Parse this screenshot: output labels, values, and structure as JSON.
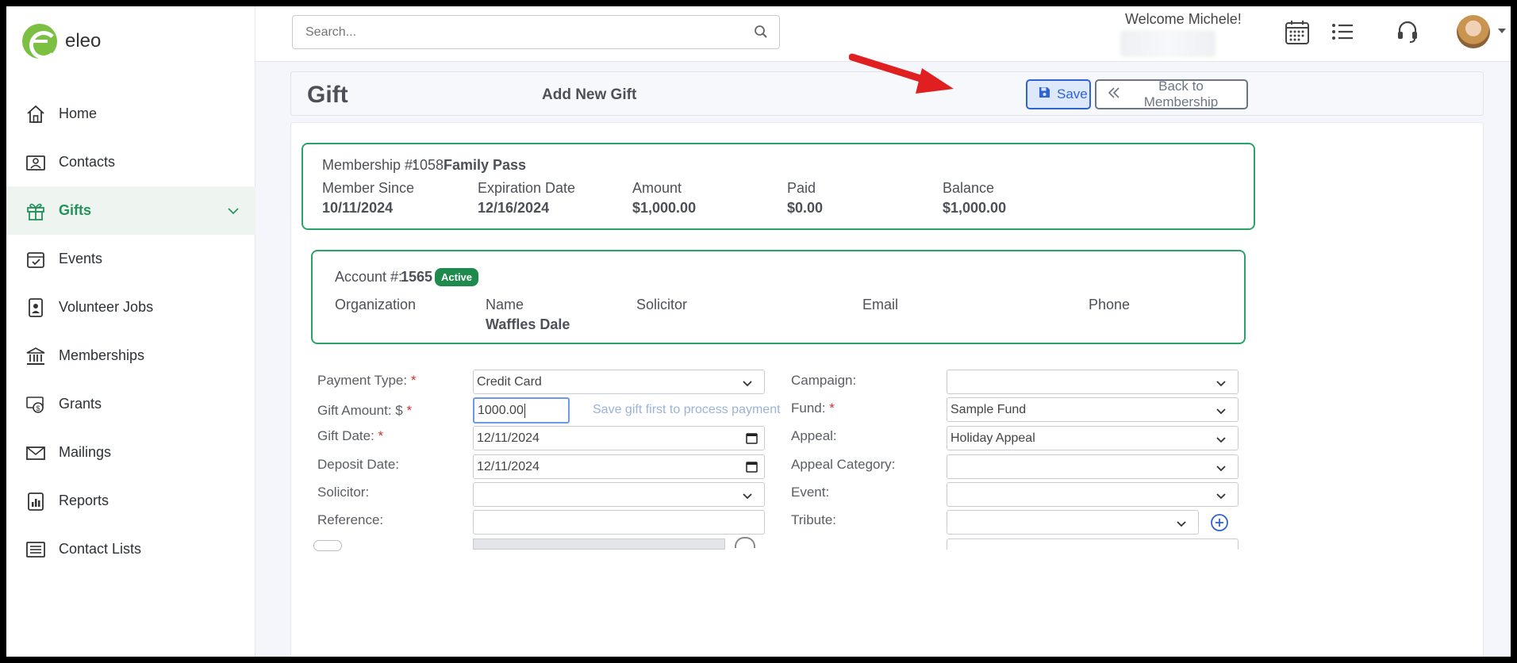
{
  "sidebar": {
    "brand": "eleo",
    "items": [
      {
        "label": "Home",
        "icon": "home-icon"
      },
      {
        "label": "Contacts",
        "icon": "contact-card-icon"
      },
      {
        "label": "Gifts",
        "icon": "gift-icon",
        "active": true
      },
      {
        "label": "Events",
        "icon": "calendar-check-icon"
      },
      {
        "label": "Volunteer Jobs",
        "icon": "badge-icon"
      },
      {
        "label": "Memberships",
        "icon": "bank-icon"
      },
      {
        "label": "Grants",
        "icon": "money-icon"
      },
      {
        "label": "Mailings",
        "icon": "envelope-icon"
      },
      {
        "label": "Reports",
        "icon": "report-icon"
      },
      {
        "label": "Contact Lists",
        "icon": "list-icon"
      }
    ]
  },
  "topbar": {
    "search_placeholder": "Search...",
    "welcome": "Welcome Michele!"
  },
  "header": {
    "title": "Gift",
    "subtitle": "Add New Gift",
    "save_label": "Save",
    "back_label": "Back to Membership"
  },
  "membership": {
    "number_label": "Membership #:",
    "number": "1058",
    "type": "Family Pass",
    "member_since_label": "Member Since",
    "member_since": "10/11/2024",
    "expiration_label": "Expiration Date",
    "expiration": "12/16/2024",
    "amount_label": "Amount",
    "amount": "$1,000.00",
    "paid_label": "Paid",
    "paid": "$0.00",
    "balance_label": "Balance",
    "balance": "$1,000.00"
  },
  "account": {
    "number_label": "Account #:",
    "number": "1565",
    "status": "Active",
    "organization_label": "Organization",
    "organization": "",
    "name_label": "Name",
    "name": "Waffles Dale",
    "solicitor_label": "Solicitor",
    "email_label": "Email",
    "phone_label": "Phone"
  },
  "form": {
    "payment_type_label": "Payment Type:",
    "payment_type": "Credit Card",
    "gift_amount_label": "Gift Amount: $",
    "gift_amount": "1000.00",
    "payment_hint": "Save gift first to process payment",
    "gift_date_label": "Gift Date:",
    "gift_date": "12/11/2024",
    "deposit_date_label": "Deposit Date:",
    "deposit_date": "12/11/2024",
    "solicitor_label": "Solicitor:",
    "solicitor": "",
    "reference_label": "Reference:",
    "reference": "",
    "campaign_label": "Campaign:",
    "campaign": "",
    "fund_label": "Fund:",
    "fund": "Sample Fund",
    "appeal_label": "Appeal:",
    "appeal": "Holiday Appeal",
    "appeal_category_label": "Appeal Category:",
    "appeal_category": "",
    "event_label": "Event:",
    "event": "",
    "tribute_label": "Tribute:",
    "tribute": ""
  },
  "colors": {
    "accent_green": "#2ba368",
    "active_badge": "#1f8a4e",
    "save_blue": "#2f63d3",
    "annotation_arrow": "#e02020"
  }
}
